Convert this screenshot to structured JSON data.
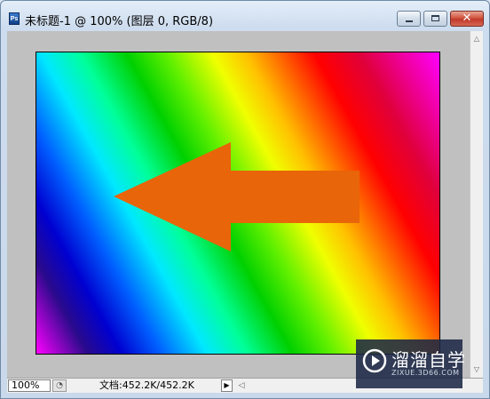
{
  "window": {
    "app_icon_label": "Ps",
    "title": "未标题-1 @ 100% (图层 0, RGB/8)",
    "minimize_glyph": "",
    "close_glyph": "✕"
  },
  "canvas": {
    "content": "rainbow-gradient",
    "arrow_color": "#e8650a",
    "arrow_direction": "left"
  },
  "statusbar": {
    "zoom": "100%",
    "doc_info": "文档:452.2K/452.2K",
    "menu_arrow": "▶",
    "scroll_left": "◁"
  },
  "scrollbar": {
    "up": "△",
    "down": "▽"
  },
  "watermark": {
    "brand": "溜溜自学",
    "url": "ZIXUE.3D66.COM"
  },
  "colors": {
    "docarea_bg": "#c0c0c0",
    "close_button": "#c0392b",
    "arrow": "#e8650a"
  }
}
